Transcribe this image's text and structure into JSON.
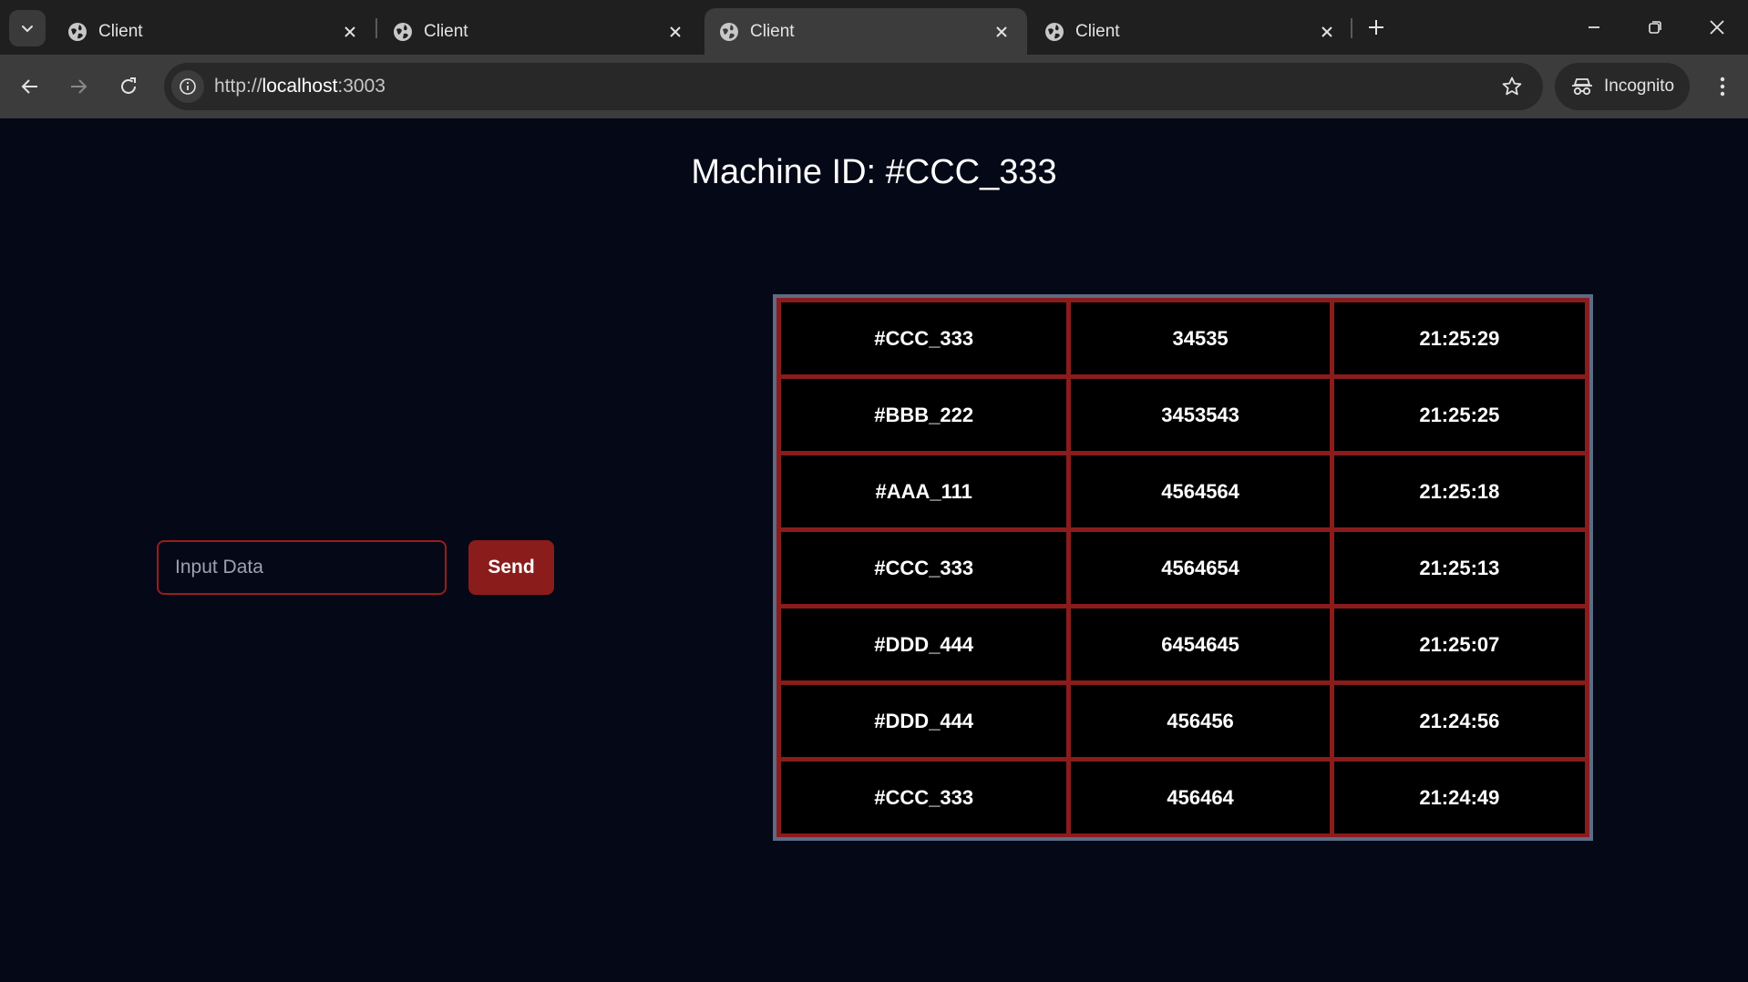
{
  "browser": {
    "tabs": [
      {
        "title": "Client",
        "active": false
      },
      {
        "title": "Client",
        "active": false
      },
      {
        "title": "Client",
        "active": true
      },
      {
        "title": "Client",
        "active": false
      }
    ],
    "url_host": "localhost",
    "url_prefix": "http://",
    "url_suffix": ":3003",
    "profile_label": "Incognito"
  },
  "page": {
    "title": "Machine ID: #CCC_333",
    "input_placeholder": "Input Data",
    "send_label": "Send"
  },
  "table": {
    "rows": [
      {
        "id": "#CCC_333",
        "value": "34535",
        "time": "21:25:29"
      },
      {
        "id": "#BBB_222",
        "value": "3453543",
        "time": "21:25:25"
      },
      {
        "id": "#AAA_111",
        "value": "4564564",
        "time": "21:25:18"
      },
      {
        "id": "#CCC_333",
        "value": "4564654",
        "time": "21:25:13"
      },
      {
        "id": "#DDD_444",
        "value": "6454645",
        "time": "21:25:07"
      },
      {
        "id": "#DDD_444",
        "value": "456456",
        "time": "21:24:56"
      },
      {
        "id": "#CCC_333",
        "value": "456464",
        "time": "21:24:49"
      }
    ]
  },
  "colors": {
    "accent_red": "#8b1c1c",
    "table_frame": "#5e6b85",
    "page_bg": "#050816"
  }
}
